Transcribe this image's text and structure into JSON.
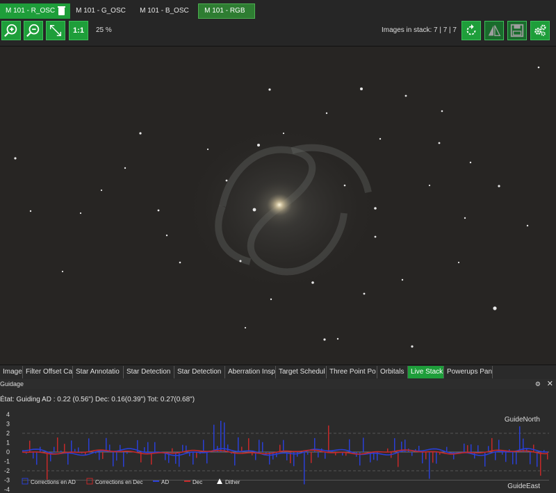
{
  "top_tabs": [
    {
      "label": "M 101 - R_OSC",
      "active": true
    },
    {
      "label": "M 101 - G_OSC",
      "active": false
    },
    {
      "label": "M 101 - B_OSC",
      "active": false
    },
    {
      "label": "M 101 - RGB",
      "active": false
    }
  ],
  "toolbar": {
    "zoom_in_icon": "zoom-in-icon",
    "zoom_out_icon": "zoom-out-icon",
    "fit_icon": "fit-diagonal-icon",
    "one_to_one_label": "1:1",
    "zoom_level": "25 %",
    "stack_info": "Images in stack: 7 | 7 | 7",
    "refresh_icon": "refresh-icon",
    "flip_icon": "flip-icon",
    "save_icon": "save-icon",
    "settings_icon": "gears-icon"
  },
  "bottom_tabs": [
    {
      "label": "Image",
      "active": false
    },
    {
      "label": "Filter Offset Ca",
      "active": false
    },
    {
      "label": "Star Annotatio",
      "active": false
    },
    {
      "label": "Star Detection",
      "active": false
    },
    {
      "label": "Star Detection",
      "active": false
    },
    {
      "label": "Aberration Insp",
      "active": false
    },
    {
      "label": "Target Schedul",
      "active": false
    },
    {
      "label": "Three Point Po",
      "active": false
    },
    {
      "label": "Orbitals",
      "active": false
    },
    {
      "label": "Live Stack",
      "active": true
    },
    {
      "label": "Powerups Pane",
      "active": false
    }
  ],
  "guide": {
    "title": "Guidage",
    "status": "État: Guiding  AD : 0.22 (0.56\")  Dec: 0.16(0.39\")  Tot: 0.27(0.68\")",
    "label_north": "GuideNorth",
    "label_east": "GuideEast",
    "y_ticks": [
      "4",
      "3",
      "2",
      "1",
      "0",
      "-1",
      "-2",
      "-3",
      "-4"
    ],
    "legend": [
      {
        "label": "Corrections en AD",
        "color": "#2a3fd6"
      },
      {
        "label": "Corrections en Dec",
        "color": "#c62828"
      },
      {
        "label": "AD",
        "color": "#2a3fd6"
      },
      {
        "label": "Dec",
        "color": "#c62828"
      },
      {
        "label": "Dither",
        "color": "#ffffff"
      }
    ]
  },
  "colors": {
    "accent": "#1e9e3a",
    "ra": "#2a3fd6",
    "dec": "#c62828"
  }
}
